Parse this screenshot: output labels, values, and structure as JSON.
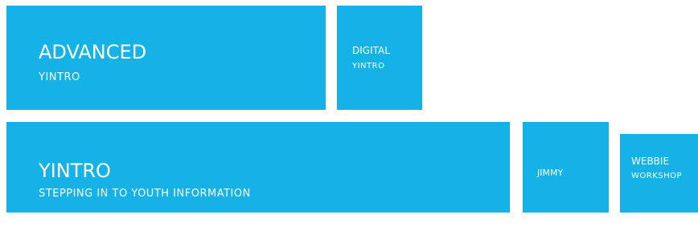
{
  "colors": {
    "tile_bg": "#14b2e6",
    "text": "#ffffff",
    "page_bg": "#ffffff"
  },
  "tiles": [
    {
      "id": "advanced",
      "title": "Advanced",
      "subtitle": "YINTRO"
    },
    {
      "id": "digital",
      "title": "Digital",
      "subtitle": "YINTRO"
    },
    {
      "id": "yintro",
      "title": "Yintro",
      "subtitle": "STEPPING IN TO YOUTH INFORMATION"
    },
    {
      "id": "jimmy",
      "title": "Jimmy",
      "subtitle": ""
    },
    {
      "id": "webbie",
      "title": "Webbie",
      "subtitle": "WORKSHOP"
    }
  ]
}
